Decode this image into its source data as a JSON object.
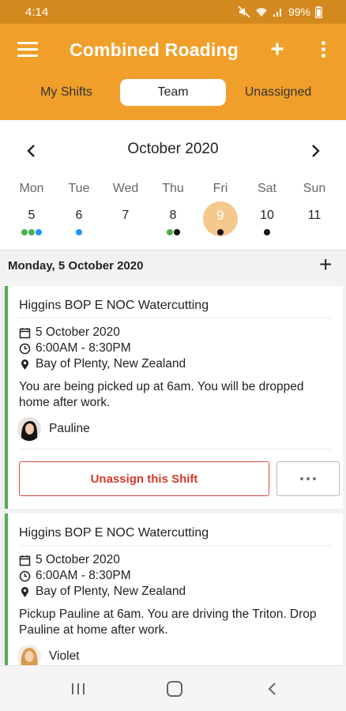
{
  "status_bar": {
    "time": "4:14",
    "battery": "99%"
  },
  "app_bar": {
    "title": "Combined Roading"
  },
  "tabs": [
    {
      "label": "My Shifts"
    },
    {
      "label": "Team"
    },
    {
      "label": "Unassigned"
    }
  ],
  "calendar": {
    "month": "October 2020",
    "weekdays": [
      "Mon",
      "Tue",
      "Wed",
      "Thu",
      "Fri",
      "Sat",
      "Sun"
    ],
    "days": [
      {
        "num": "5",
        "dots": [
          "#4caf50",
          "#4caf50",
          "#2196f3"
        ]
      },
      {
        "num": "6",
        "dots": [
          "#2196f3"
        ]
      },
      {
        "num": "7",
        "dots": []
      },
      {
        "num": "8",
        "dots": [
          "#4caf50",
          "#111111"
        ]
      },
      {
        "num": "9",
        "dots": [
          "#111111"
        ],
        "selected": true
      },
      {
        "num": "10",
        "dots": [
          "#111111"
        ]
      },
      {
        "num": "11",
        "dots": []
      }
    ],
    "selected_color": "#f5c88d"
  },
  "section": {
    "date_title": "Monday, 5 October 2020"
  },
  "shifts": [
    {
      "title": "Higgins BOP E NOC Watercutting",
      "date": "5 October 2020",
      "time": "6:00AM - 8:30PM",
      "location": "Bay of Plenty, New Zealand",
      "description": "You are being picked up at 6am. You will be dropped home after work.",
      "assignee": "Pauline",
      "action": "Unassign this Shift"
    },
    {
      "title": "Higgins BOP E NOC Watercutting",
      "date": "5 October 2020",
      "time": "6:00AM - 8:30PM",
      "location": "Bay of Plenty, New Zealand",
      "description": "Pickup Pauline at 6am. You are driving the Triton. Drop Pauline at home after work.",
      "assignee": "Violet"
    }
  ],
  "colors": {
    "primary": "#f0a02a",
    "status_bar": "#d4891e",
    "accent_green": "#4caf50",
    "danger": "#d63a2e"
  }
}
